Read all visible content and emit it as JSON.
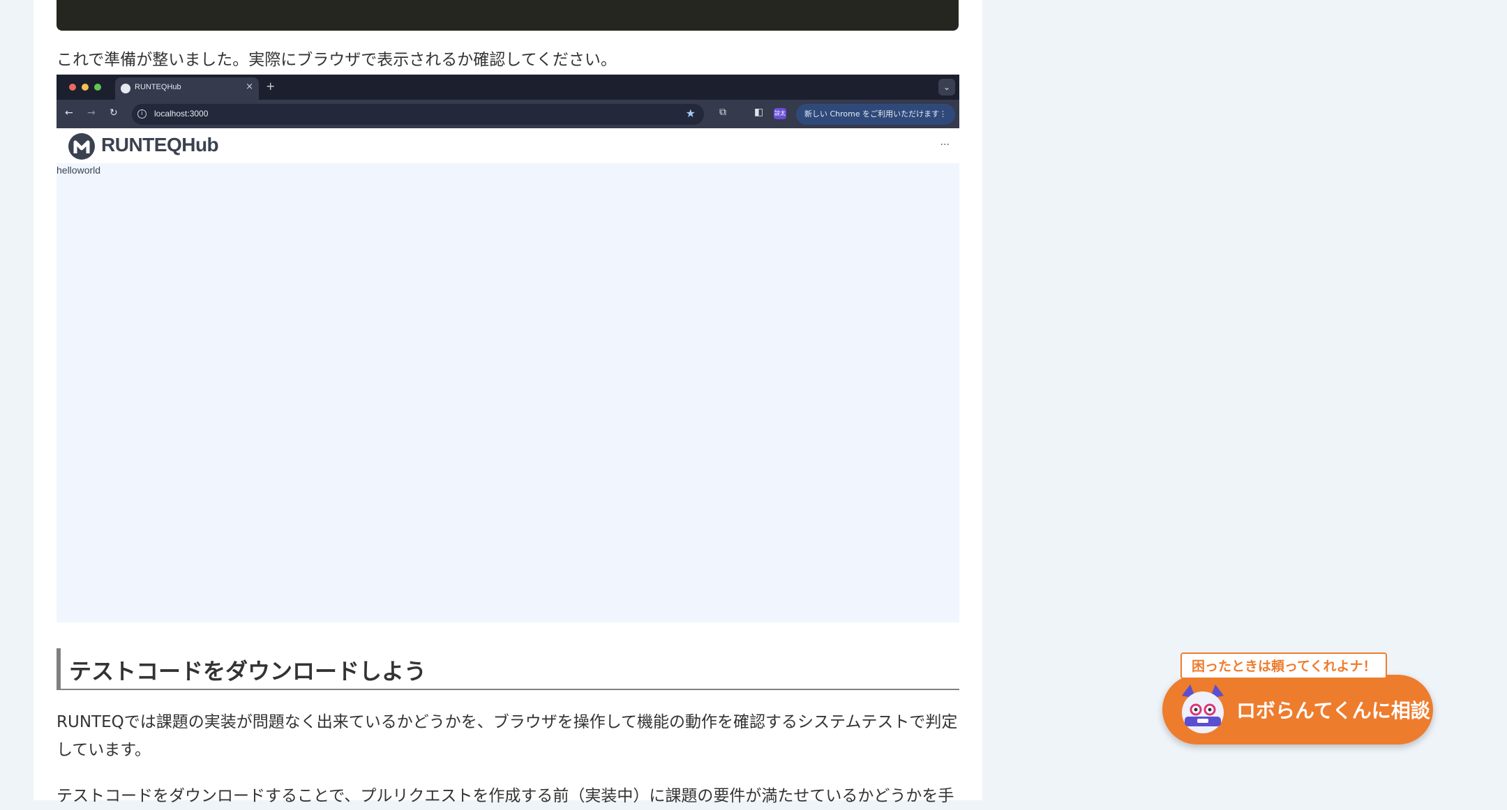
{
  "article": {
    "intro_text": "これで準備が整いました。実際にブラウザで表示されるか確認してください。",
    "section_heading": "テストコードをダウンロードしよう",
    "paragraph_1": "RUNTEQでは課題の実装が問題なく出来ているかどうかを、ブラウザを操作して機能の動作を確認するシステムテストで判定しています。",
    "paragraph_2": "テストコードをダウンロードすることで、プルリクエストを作成する前（実装中）に課題の要件が満たせているかどうかを手"
  },
  "browser_screenshot": {
    "tab_title": "RUNTEQHub",
    "tab_close": "×",
    "new_tab": "+",
    "url": "localhost:3000",
    "profile_badge": "諒太",
    "update_chip_label": "新しい Chrome をご利用いただけます",
    "site_logo_text": "RUNTEQHub",
    "site_more": "...",
    "page_text": "helloworld"
  },
  "robo_widget": {
    "tip": "困ったときは頼ってくれよナ！",
    "button_label": "ロボらんてくんに相談"
  },
  "colors": {
    "page_bg": "#eff4f8",
    "accent_orange": "#ee7c2d",
    "code_bg": "#262621",
    "screenshot_bg": "#f1f6fe"
  }
}
